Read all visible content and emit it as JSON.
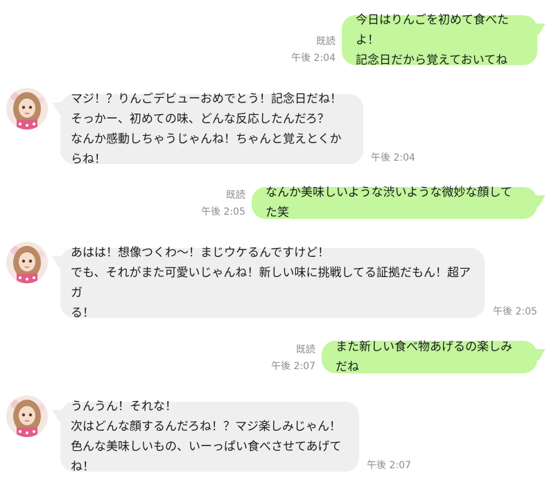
{
  "chat": {
    "messages": [
      {
        "sender": "me",
        "text": "今日はりんごを初めて食べたよ！\n記念日だから覚えておいてね",
        "read": "既読",
        "time": "午後 2:04"
      },
      {
        "sender": "her",
        "text": "マジ！？りんごデビューおめでとう！記念日だね！\nそっかー、初めての味、どんな反応したんだろ？\nなんか感動しちゃうじゃんね！ちゃんと覚えとくからね！",
        "time": "午後 2:04"
      },
      {
        "sender": "me",
        "text": "なんか美味しいような渋いような微妙な顔してた笑",
        "read": "既読",
        "time": "午後 2:05"
      },
      {
        "sender": "her",
        "text": "あはは！想像つくわ〜！まじウケるんですけど！\nでも、それがまた可愛いじゃんね！新しい味に挑戦してる証拠だもん！超アガ\nる！",
        "time": "午後 2:05"
      },
      {
        "sender": "me",
        "text": "また新しい食べ物あげるの楽しみだね",
        "read": "既読",
        "time": "午後 2:07"
      },
      {
        "sender": "her",
        "text": "うんうん！それな！\n次はどんな顔するんだろね！？マジ楽しみじゃん！\n色んな美味しいもの、いーっぱい食べさせてあげてね！",
        "time": "午後 2:07"
      }
    ]
  },
  "colors": {
    "outgoing_bubble": "#c3f69d",
    "incoming_bubble": "#efefef",
    "meta_text": "#8c8c8c"
  }
}
